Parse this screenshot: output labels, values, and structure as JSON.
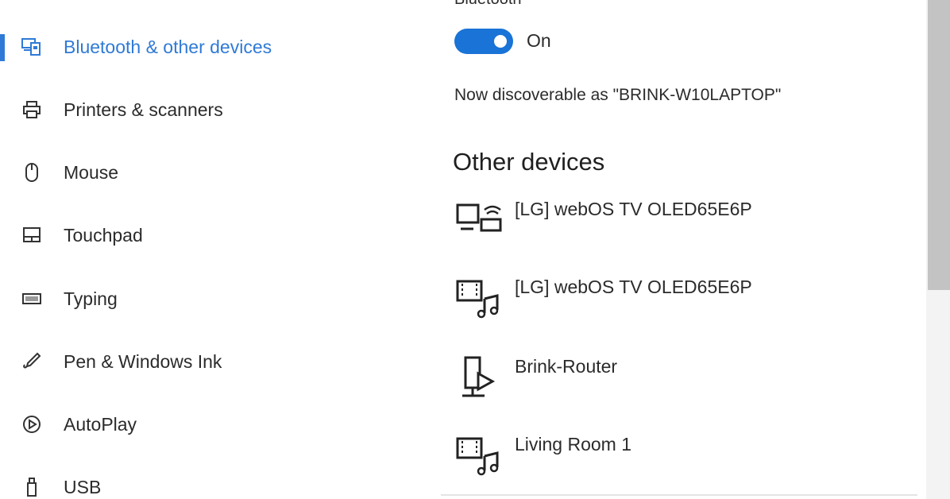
{
  "sidebar": {
    "items": [
      {
        "label": "Bluetooth & other devices",
        "icon": "bluetooth-devices-icon",
        "selected": true
      },
      {
        "label": "Printers & scanners",
        "icon": "printer-icon",
        "selected": false
      },
      {
        "label": "Mouse",
        "icon": "mouse-icon",
        "selected": false
      },
      {
        "label": "Touchpad",
        "icon": "touchpad-icon",
        "selected": false
      },
      {
        "label": "Typing",
        "icon": "keyboard-icon",
        "selected": false
      },
      {
        "label": "Pen & Windows Ink",
        "icon": "pen-icon",
        "selected": false
      },
      {
        "label": "AutoPlay",
        "icon": "autoplay-icon",
        "selected": false
      },
      {
        "label": "USB",
        "icon": "usb-icon",
        "selected": false
      }
    ]
  },
  "bluetooth": {
    "caption": "Bluetooth",
    "toggle_state": "On",
    "toggle_on": true,
    "discoverable_text": "Now discoverable as \"BRINK-W10LAPTOP\""
  },
  "other_devices": {
    "heading": "Other devices",
    "items": [
      {
        "name": "[LG] webOS TV OLED65E6P",
        "icon": "wireless-display-icon"
      },
      {
        "name": "[LG] webOS TV OLED65E6P",
        "icon": "media-device-icon"
      },
      {
        "name": "Brink-Router",
        "icon": "router-icon"
      },
      {
        "name": "Living Room 1",
        "icon": "media-device-icon"
      }
    ]
  },
  "colors": {
    "accent": "#2f7ad6",
    "toggle": "#1a73d6"
  }
}
